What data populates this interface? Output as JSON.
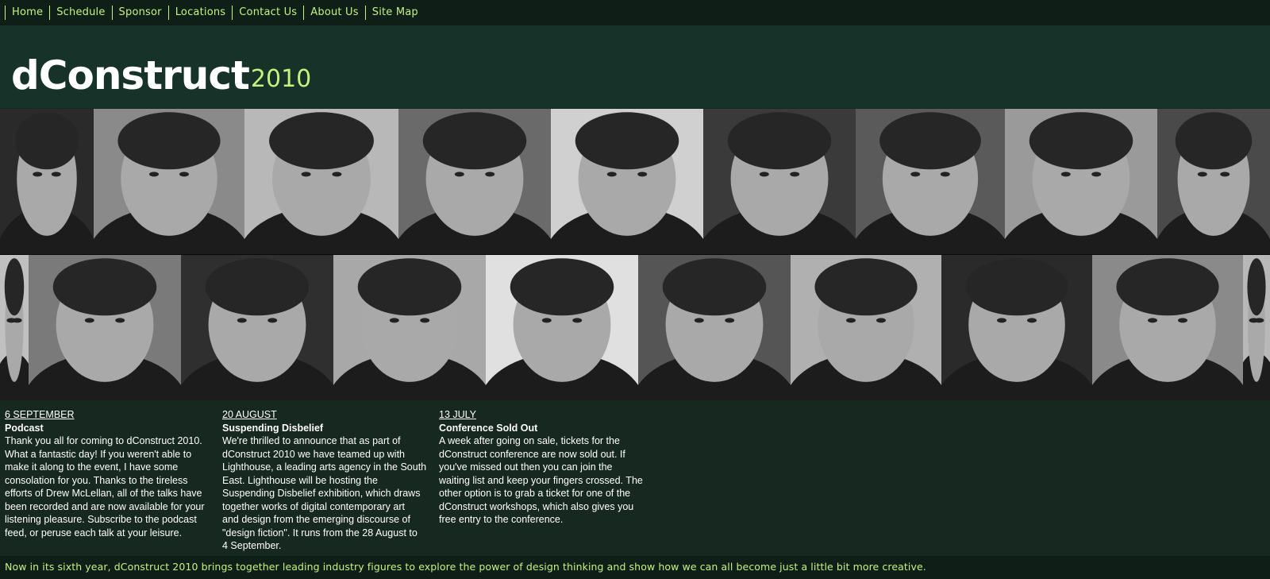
{
  "nav": {
    "items": [
      {
        "label": "Home"
      },
      {
        "label": "Schedule"
      },
      {
        "label": "Sponsor"
      },
      {
        "label": "Locations"
      },
      {
        "label": "Contact Us"
      },
      {
        "label": "About Us"
      },
      {
        "label": "Site Map"
      }
    ]
  },
  "header": {
    "logo_main": "dConstruct",
    "logo_year": "2010"
  },
  "photo_strip": {
    "description": "",
    "photos": [
      {
        "tone": "#2a2a2a"
      },
      {
        "tone": "#8a8a8a"
      },
      {
        "tone": "#b8b8b8"
      },
      {
        "tone": "#6a6a6a"
      },
      {
        "tone": "#d0d0d0"
      },
      {
        "tone": "#3a3a3a"
      },
      {
        "tone": "#5a5a5a"
      },
      {
        "tone": "#9a9a9a"
      },
      {
        "tone": "#4a4a4a"
      },
      {
        "tone": "#c0c0c0"
      },
      {
        "tone": "#7a7a7a"
      },
      {
        "tone": "#2f2f2f"
      },
      {
        "tone": "#a8a8a8"
      },
      {
        "tone": "#e0e0e0"
      },
      {
        "tone": "#555555"
      },
      {
        "tone": "#b0b0b0"
      }
    ]
  },
  "news": [
    {
      "date": "6 SEPTEMBER",
      "title": "Podcast",
      "body_lines": [
        "Thank you all for coming to dConstruct 2010.",
        "What a fantastic day! If you weren't able to",
        "make it along to the event, I have some",
        "consolation for you. Thanks to the tireless",
        "efforts of Drew McLellan, all of the talks have",
        "been recorded and are now available for your",
        "listening pleasure. Subscribe to the podcast",
        "feed, or peruse each talk at your leisure."
      ]
    },
    {
      "date": "20 AUGUST",
      "title": "Suspending Disbelief",
      "body_lines": [
        "We're thrilled to announce that as part of",
        "dConstruct 2010 we have teamed up with",
        "Lighthouse, a leading arts agency in the South",
        "East. Lighthouse will be hosting the",
        "Suspending Disbelief exhibition, which draws",
        "together works of digital contemporary art",
        "and design from the emerging discourse of",
        "\"design fiction\". It runs from the 28 August to",
        "4 September."
      ]
    },
    {
      "date": "13 JULY",
      "title": "Conference Sold Out",
      "body_lines": [
        "A week after going on sale, tickets for the",
        "dConstruct conference are now sold out. If",
        "you've missed out then you can join the",
        "waiting list and keep your fingers crossed. The",
        "other option is to grab a ticket for one of the",
        "dConstruct workshops, which also gives you",
        "free entry to the conference."
      ]
    }
  ],
  "footer": {
    "text": "Now in its sixth year, dConstruct 2010 brings together leading industry figures to explore the power of design thinking and show how we can all become just a little bit more creative."
  },
  "colors": {
    "background": "#16281f",
    "header_bg": "#173228",
    "nav_bg": "#0f1f18",
    "accent": "#c6f17f",
    "text": "#ffffff"
  }
}
